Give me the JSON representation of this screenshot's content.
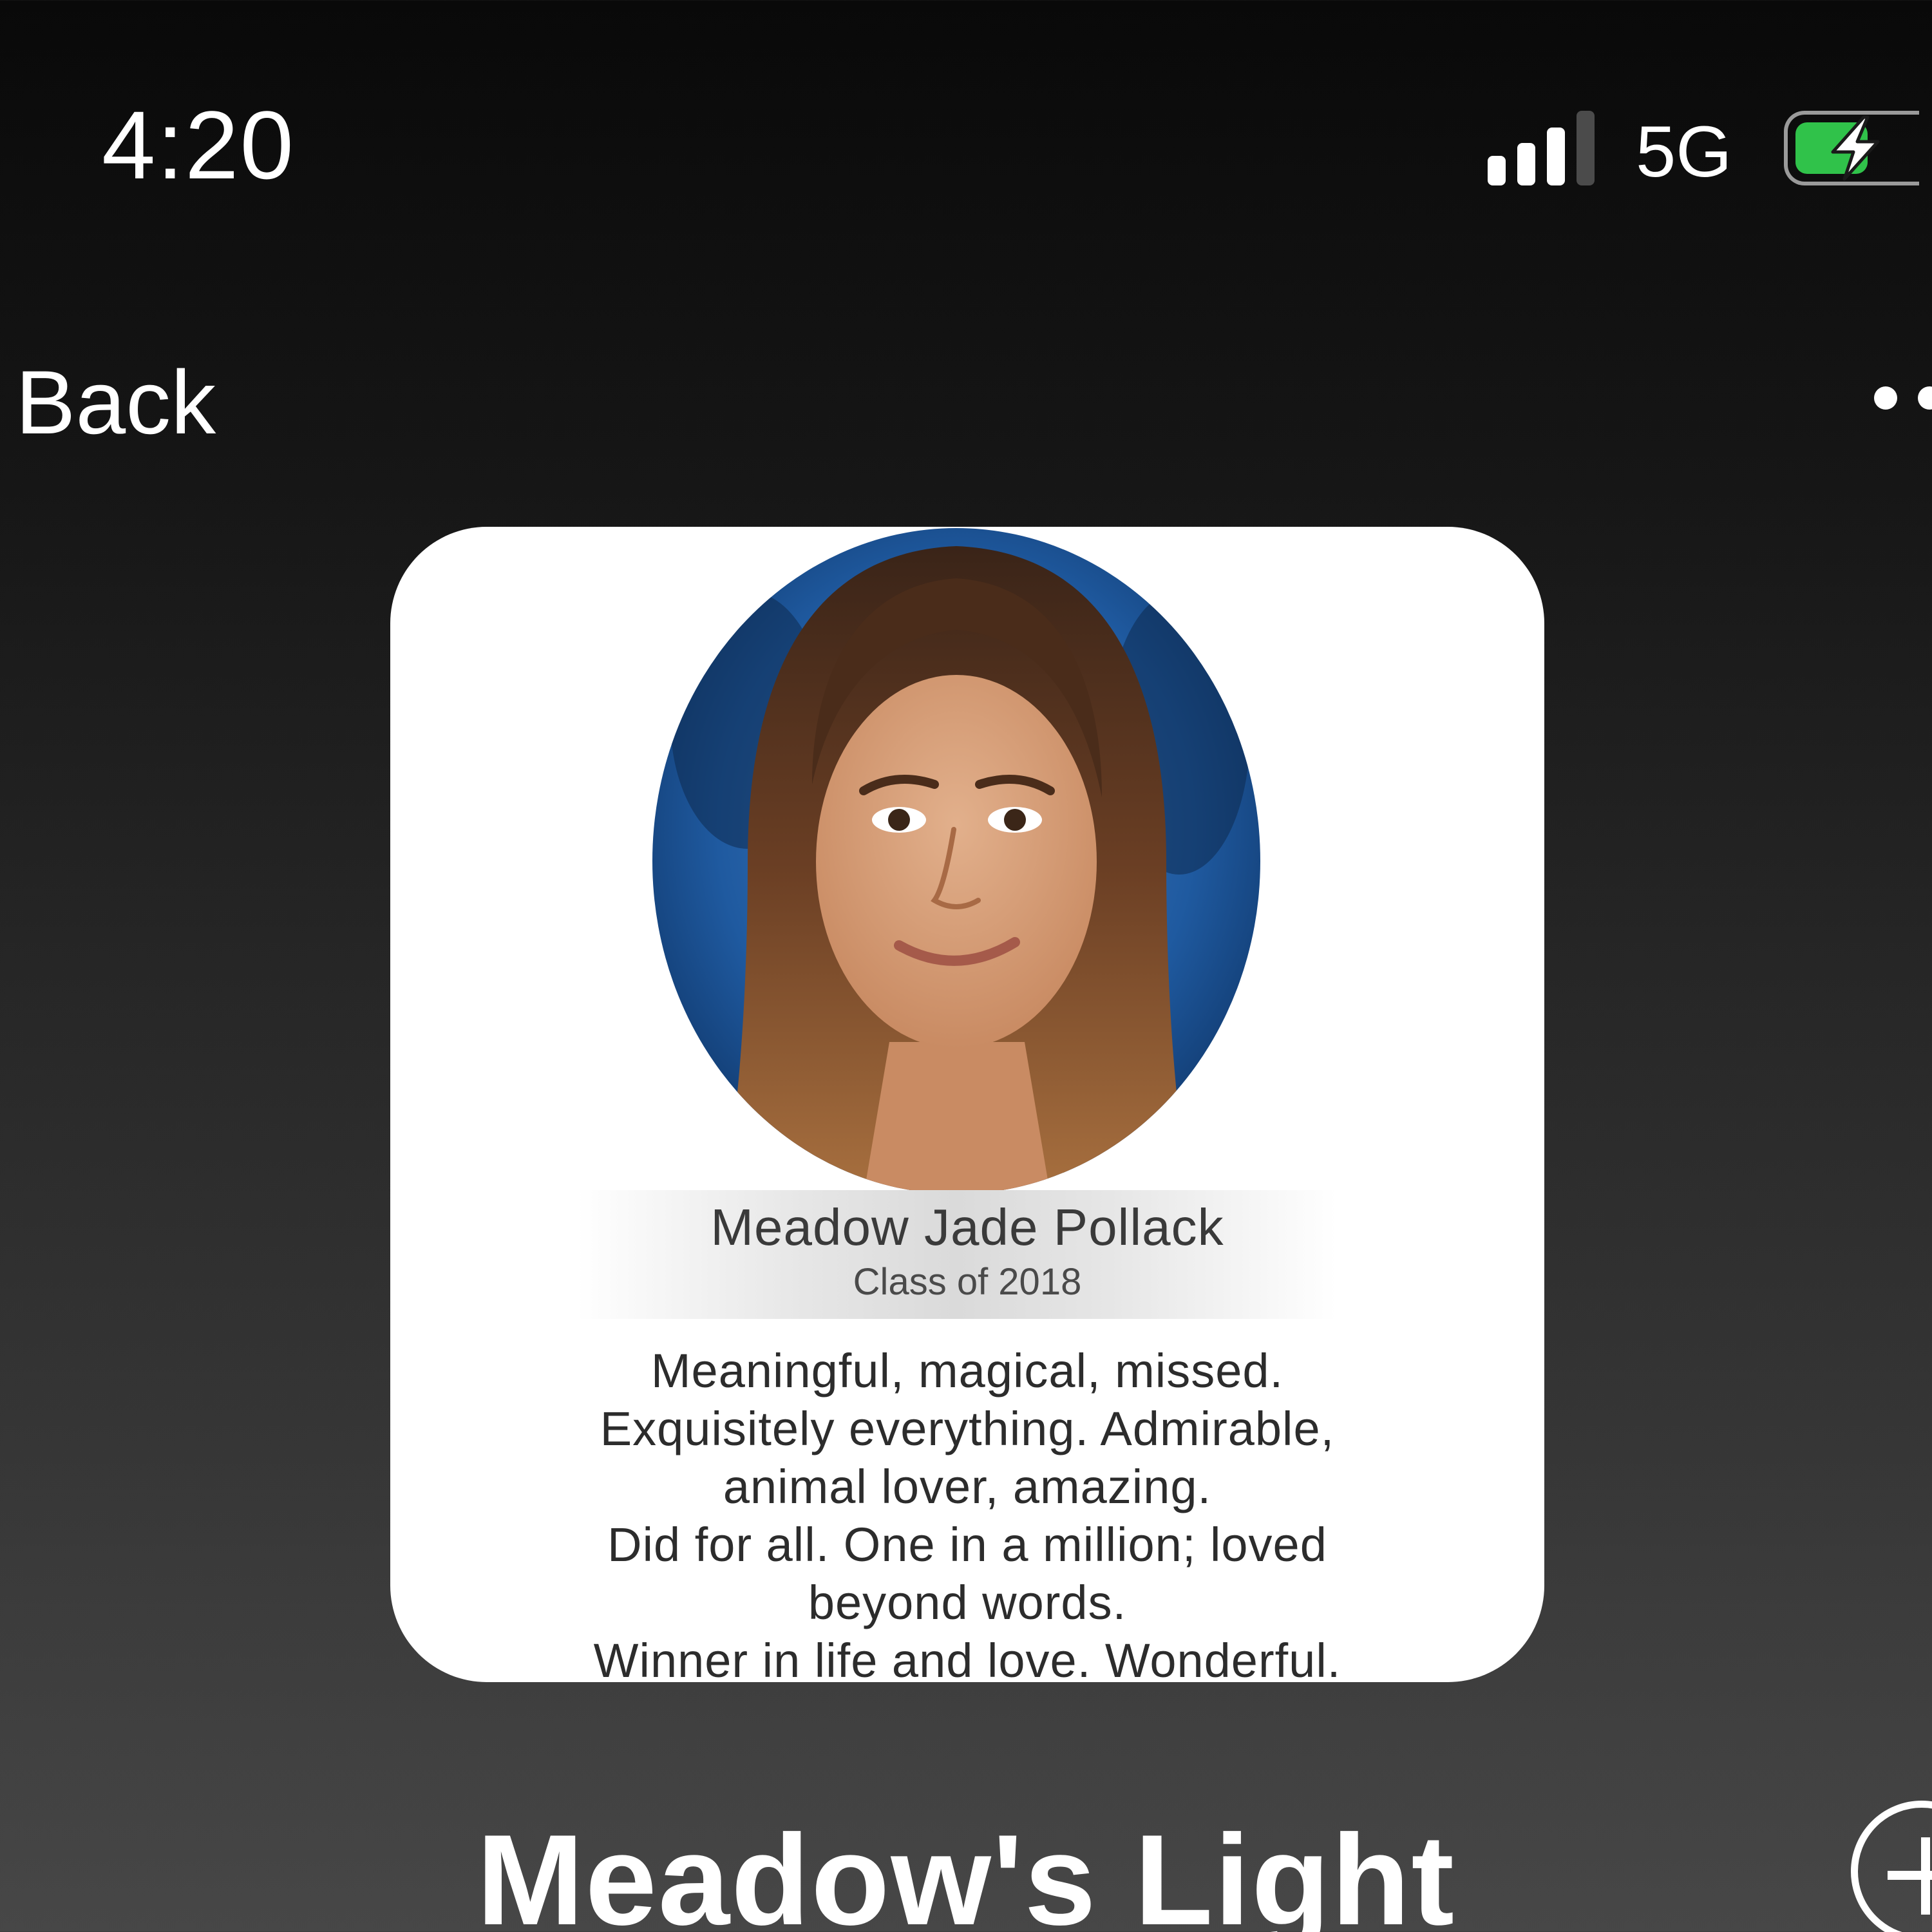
{
  "status_bar": {
    "time": "4:20",
    "network": "5G",
    "signal_bars_active": 3,
    "signal_bars_total": 4,
    "battery_level": 0.6,
    "battery_charging": true,
    "battery_color": "#30c24a",
    "icons": [
      "signal-icon",
      "battery-charging-icon"
    ]
  },
  "nav": {
    "back_label": "Back",
    "more_icon": "ellipsis-icon"
  },
  "card": {
    "name": "Meadow Jade Pollack",
    "class_of": "Class of 2018",
    "poem_lines": [
      "Meaningful, magical, missed.",
      "Exquisitely everything. Admirable,",
      "animal lover, amazing.",
      "Did for all. One in a million; loved",
      "beyond words.",
      "Winner in life and love. Wonderful."
    ]
  },
  "page": {
    "title": "Meadow's Light",
    "add_icon": "plus-circle-icon"
  }
}
